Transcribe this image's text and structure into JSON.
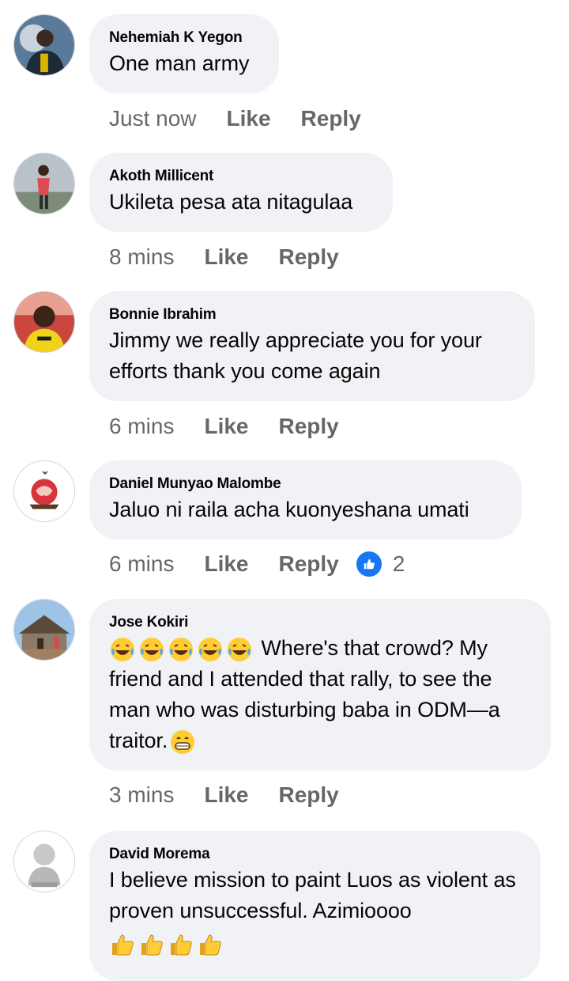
{
  "comments": [
    {
      "author": "Nehemiah K Yegon",
      "text": "One man army",
      "time": "Just now",
      "like_label": "Like",
      "reply_label": "Reply"
    },
    {
      "author": "Akoth Millicent",
      "text": "Ukileta pesa ata nitagulaa",
      "time": "8 mins",
      "like_label": "Like",
      "reply_label": "Reply"
    },
    {
      "author": "Bonnie Ibrahim",
      "text": "Jimmy we really appreciate you for your efforts thank you come again",
      "time": "6 mins",
      "like_label": "Like",
      "reply_label": "Reply"
    },
    {
      "author": "Daniel Munyao Malombe",
      "text": "Jaluo ni raila acha kuonyeshana umati",
      "time": "6 mins",
      "like_label": "Like",
      "reply_label": "Reply",
      "reaction": {
        "icon": "thumbs-up-icon",
        "count": "2"
      }
    },
    {
      "author": "Jose Kokiri",
      "text_line1": " Where's that crowd? My",
      "text_rest": "friend and I attended that rally, to see the man who was disturbing baba in ODM—a traitor.",
      "lead_emoji": "laughing-tears-emoji",
      "trail_emoji": "grin-emoji",
      "time": "3 mins",
      "like_label": "Like",
      "reply_label": "Reply"
    },
    {
      "author": "David Morema",
      "text": "I believe mission to paint Luos as violent as proven unsuccessful. Azimioooo",
      "trail_emoji": "thumbs-up-emoji"
    }
  ],
  "colors": {
    "bubble": "#f0f2f5",
    "meta": "#65676b",
    "like_blue": "#1877f2"
  }
}
